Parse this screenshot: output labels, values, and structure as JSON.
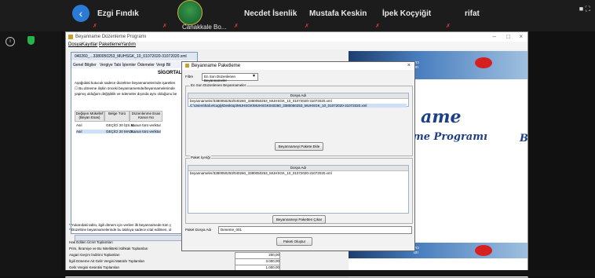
{
  "meeting": {
    "participants": [
      {
        "name": "Ezgi Fındık",
        "muted": true
      },
      {
        "name": "Canakkale Bo...",
        "muted": true
      },
      {
        "name": "Necdet İsenlik",
        "muted": true
      },
      {
        "name": "Mustafa Keskin",
        "muted": true
      },
      {
        "name": "İpek Koçyiğit",
        "muted": true
      },
      {
        "name": "rifat",
        "muted": true
      }
    ],
    "back_icon": "arrow-left-icon",
    "mic_icon": "mic-off-icon"
  },
  "app": {
    "title": "Beyanname Düzenleme Programı",
    "menu": [
      "Dosya",
      "Kayıtlar",
      "Paketleme",
      "Yardım"
    ],
    "brand_word1": "ame",
    "brand_word2": "me Programı",
    "brand_word3": "Bey",
    "banner_text": "ırcı\nurı",
    "banner_text_lower": "ırcı\nurı",
    "accent_color": "#1d3f86"
  },
  "form": {
    "title": "040260_...3380050253_MUHSGK_10_01072020-31072020.xml",
    "tabs": [
      "Genel Bilgiler",
      "Vergiye Tabi İşlemler",
      "Ödemeler",
      "Vergi Bil"
    ],
    "heading": "SİGORTALI",
    "note1": "Aşağıdaki kutucuk sadece düzeltme beyannamelerinde işaretlen",
    "note2": "Bu döneme ilişkin önceki beyannamemde/beyannamelerimde",
    "note3": "yapmış olduğum değişiklik ve ödemeler dışında aynı olduğunu be",
    "table_headers": [
      "Değişen Mükellef (Beyan Esas)",
      "Belge Türü",
      "Düzenlenme Esas Kanun No"
    ],
    "rows": [
      [
        "Asıl",
        "GEÇİCİ 20 İŞS.M...",
        "Kanun türü veriktur"
      ],
      [
        "Asıl",
        "GEÇİCİ 20 MADI...",
        "Kanun türü veriktur"
      ]
    ],
    "footnote1": "* Yukarıdaki tablo, ilgili dönem için verilen ilk beyannamede tüm ç",
    "footnote2": "* Düzeltme beyannamelerinde bu tabloya sadece ictal edilmen, ol"
  },
  "bottom_list": [
    {
      "label": "Hak Edilen Ücret Toplamları",
      "value": ""
    },
    {
      "label": "Prim, İkramiye ve Bu Nitelikteki İstihkak Toplamları",
      "value": ""
    },
    {
      "label": "Asgari Geçim İndirimi Toplamları",
      "value": "200,00"
    },
    {
      "label": "İlgili Döneme Ait Gelir Vergisi Matrahı Toplamları",
      "value": "3.000,00"
    },
    {
      "label": "Gelir Vergisi Kesintisi Toplamları",
      "value": "1.000,00"
    }
  ],
  "dialog": {
    "title": "Beyanname Paketleme",
    "filter_label": "Filtre",
    "filter_value": "En Son Düzenlenen Beyannameler",
    "group1_label": "En Son Düzenlenen Beyannameler",
    "list1_header": "Dosya Adı",
    "list1_rows": [
      "beyannameler/3380050253/040260_3380050253_MUHSGK_10_01072020-31072020.xml",
      "C:\\Users\\hali.elcogly\\Desktop\\MUHSGK\\MUHSGK040260_3380050253_MUHSGK_10_01072020-31072020.xml"
    ],
    "add_button": "Beyannameyi Pakete Ekle",
    "group2_label": "Paket İçeriği",
    "list2_header": "Dosya Adı",
    "list2_rows": [
      "beyannameler/3380050253/040260_3380050253_MUHSGK_10_01072020-31072020.xml"
    ],
    "remove_button": "Beyannameyi Paketten Çıkar",
    "package_name_label": "Paket Dosya Adı",
    "package_name_value": "Deneme_001",
    "create_button": "Paketi Oluştur"
  }
}
